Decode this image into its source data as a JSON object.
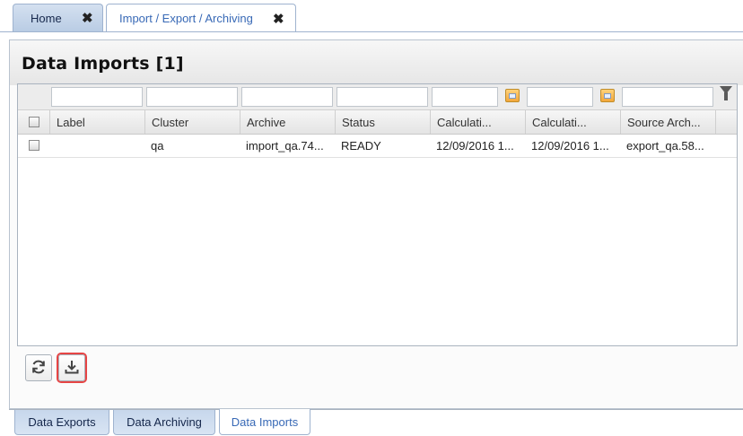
{
  "top_tabs": [
    {
      "label": "Home",
      "close": "✖"
    },
    {
      "label": "Import / Export / Archiving",
      "close": "✖"
    }
  ],
  "panel": {
    "title": "Data Imports [1]"
  },
  "grid": {
    "columns": [
      "Label",
      "Cluster",
      "Archive",
      "Status",
      "Calculati...",
      "Calculati...",
      "Source Arch..."
    ],
    "rows": [
      {
        "label": "",
        "cluster": "qa",
        "archive": "import_qa.74...",
        "status": "READY",
        "calc1": "12/09/2016 1...",
        "calc2": "12/09/2016 1...",
        "source_archive": "export_qa.58..."
      }
    ]
  },
  "toolbar": {
    "refresh_icon": "refresh-icon",
    "import_icon": "download-icon",
    "highlight_color": "#e64545"
  },
  "bottom_tabs": [
    {
      "label": "Data Exports"
    },
    {
      "label": "Data Archiving"
    },
    {
      "label": "Data Imports"
    }
  ]
}
